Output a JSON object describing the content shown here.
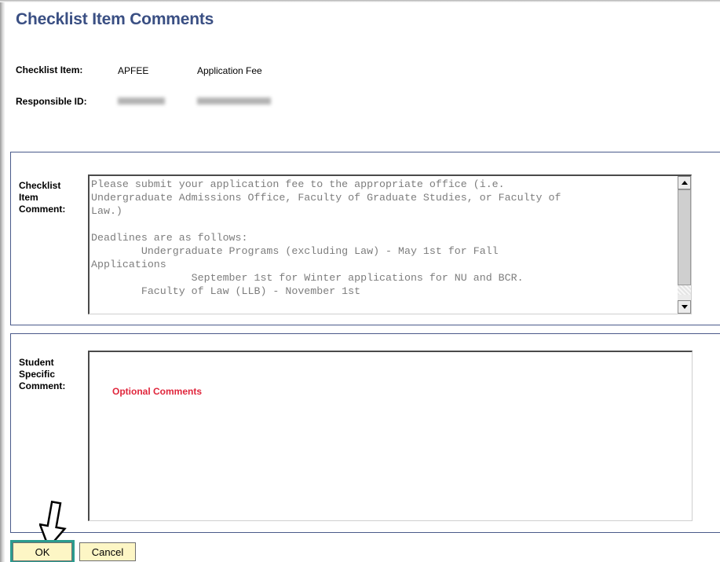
{
  "page": {
    "title": "Checklist Item Comments"
  },
  "checklist_item": {
    "label": "Checklist Item:",
    "code": "APFEE",
    "description": "Application Fee"
  },
  "responsible": {
    "label": "Responsible ID:"
  },
  "checklist_comment": {
    "label_line1": "Checklist",
    "label_line2": "Item",
    "label_line3": "Comment:",
    "text": "Please submit your application fee to the appropriate office (i.e.\nUndergraduate Admissions Office, Faculty of Graduate Studies, or Faculty of\nLaw.)\n\nDeadlines are as follows:\n        Undergraduate Programs (excluding Law) - May 1st for Fall\nApplications\n                September 1st for Winter applications for NU and BCR.\n        Faculty of Law (LLB) - November 1st"
  },
  "student_comment": {
    "label_line1": "Student",
    "label_line2": "Specific",
    "label_line3": "Comment:",
    "overlay_text": "Optional Comments"
  },
  "buttons": {
    "ok": "OK",
    "cancel": "Cancel"
  },
  "icons": {
    "scroll_up": "scroll-up-icon",
    "scroll_down": "scroll-down-icon",
    "pointer": "down-arrow-pointer-icon"
  },
  "colors": {
    "title": "#3a4f83",
    "button_bg": "#fdf6c5",
    "ok_highlight": "#2b9c8f",
    "optional_text": "#e0263c"
  }
}
